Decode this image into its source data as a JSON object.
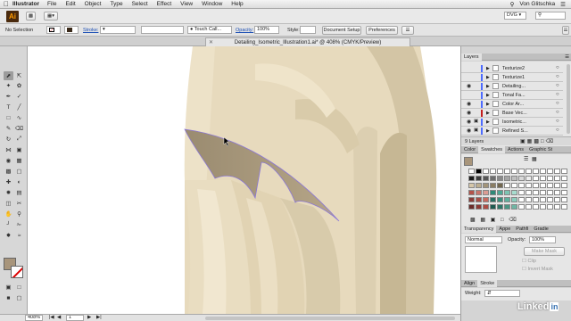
{
  "menubar": {
    "app_name": "Illustrator",
    "items": [
      "File",
      "Edit",
      "Object",
      "Type",
      "Select",
      "Effect",
      "View",
      "Window",
      "Help"
    ],
    "user": "Von Glitschka"
  },
  "appbar": {
    "logo": "Ai",
    "workspace": "DVG"
  },
  "control_bar": {
    "selection": "No Selection",
    "stroke_label": "Stroke:",
    "brush_name": "Touch Call...",
    "opacity_label": "Opacity:",
    "opacity_value": "100%",
    "style_label": "Style:",
    "document_setup": "Document Setup",
    "preferences": "Preferences"
  },
  "document_tab": {
    "title": "Detailing_Isometric_Illustration1.ai* @ 408% (CMYK/Preview)"
  },
  "status_bar": {
    "zoom": "408%",
    "artboard": "1"
  },
  "layers_panel": {
    "tab": "Layers",
    "rows": [
      {
        "name": "Texturize2",
        "color": "#4d6bff",
        "visible": false,
        "locked": false
      },
      {
        "name": "Texturize1",
        "color": "#4d6bff",
        "visible": false,
        "locked": false
      },
      {
        "name": "Detailing...",
        "color": "#4d6bff",
        "visible": true,
        "locked": false
      },
      {
        "name": "Tonal Fa...",
        "color": "#4d6bff",
        "visible": false,
        "locked": false
      },
      {
        "name": "Color Ar...",
        "color": "#4d6bff",
        "visible": true,
        "locked": false
      },
      {
        "name": "Base Vec...",
        "color": "#c41e1e",
        "visible": true,
        "locked": false
      },
      {
        "name": "Isometric...",
        "color": "#4d6bff",
        "visible": true,
        "locked": true
      },
      {
        "name": "Refined S...",
        "color": "#4d6bff",
        "visible": true,
        "locked": true
      }
    ],
    "count": "9 Layers"
  },
  "swatches_panel": {
    "tabs": [
      "Color",
      "Swatches",
      "Actions",
      "Graphic St"
    ]
  },
  "transparency_panel": {
    "tabs": [
      "Transparency",
      "Appe",
      "Pathfi",
      "Gradie"
    ],
    "mode": "Normal",
    "opacity_label": "Opacity:",
    "opacity_value": "100%",
    "make_mask": "Make Mask",
    "clip": "Clip",
    "invert_mask": "Invert Mask"
  },
  "stroke_panel": {
    "tabs": [
      "Align",
      "Stroke"
    ],
    "weight_label": "Weight:"
  },
  "watermark": {
    "text": "Linked",
    "in": "in"
  }
}
